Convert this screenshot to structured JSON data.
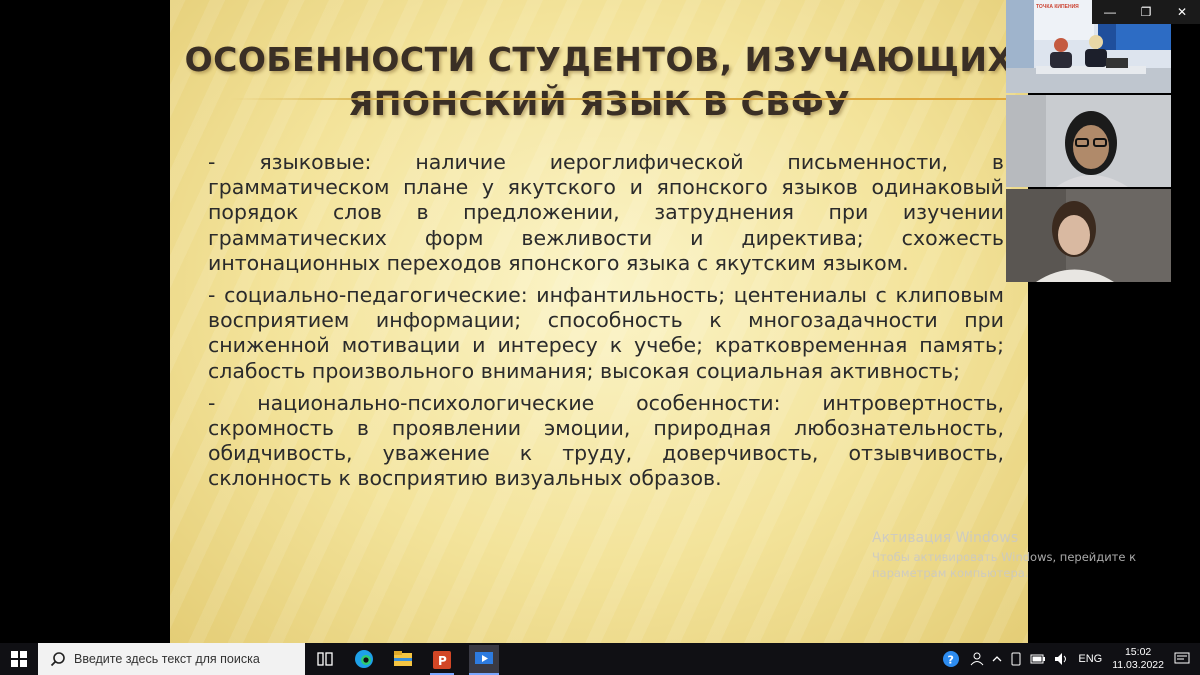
{
  "slide": {
    "title_line1": "Особенности студентов, изучающих",
    "title_line2": "японский язык в СВФУ",
    "paragraphs": [
      "- языковые: наличие иероглифической письменности, в грамматическом плане у якутского и японского языков одинаковый порядок слов в предложении, затруднения при изучении грамматических форм вежливости и директива; схожесть интонационных переходов японского языка с якутским языком.",
      "- социально-педагогические: инфантильность; центениалы с клиповым восприятием информации; способность к многозадачности при сниженной мотивации и интересу к учебе; кратковременная память; слабость произвольного внимания; высокая социальная активность;",
      "- национально-психологические особенности: интровертность, скромность в проявлении эмоции, природная любознательность, обидчивость, уважение к труду, доверчивость, отзывчивость, склонность к восприятию визуальных образов."
    ]
  },
  "activation": {
    "title": "Активация Windows",
    "subtitle_line1": "Чтобы активировать Windows, перейдите к",
    "subtitle_line2": "параметрам компьютера."
  },
  "window_controls": {
    "minimize": "—",
    "restore": "❐",
    "close": "✕"
  },
  "video_feeds": {
    "feed1_banner": "ТОЧКА КИПЕНИЯ"
  },
  "taskbar": {
    "search_placeholder": "Введите здесь текст для поиска",
    "language": "ENG",
    "time": "15:02",
    "date": "11.03.2022"
  },
  "colors": {
    "slide_text": "#2b2b2b",
    "title_text": "#3a2f25",
    "taskbar_bg": "#101014"
  }
}
